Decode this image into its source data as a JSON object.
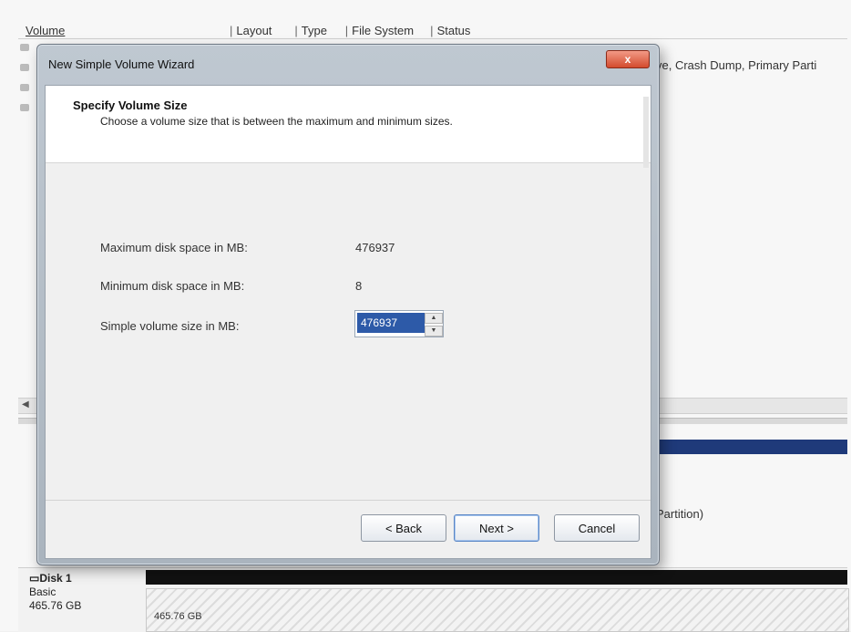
{
  "background": {
    "columns": {
      "volume": "Volume",
      "layout": "Layout",
      "type": "Type",
      "file_system": "File System",
      "status": "Status"
    },
    "status_partial": "ve, Crash Dump, Primary Parti",
    "partition_partial": "Partition)",
    "disk1": {
      "name": "Disk 1",
      "type": "Basic",
      "size": "465.76 GB",
      "unallocated_size": "465.76 GB"
    }
  },
  "wizard": {
    "title": "New Simple Volume Wizard",
    "close_label": "x",
    "page_title": "Specify Volume Size",
    "page_subtitle": "Choose a volume size that is between the maximum and minimum sizes.",
    "max_label": "Maximum disk space in MB:",
    "max_value": "476937",
    "min_label": "Minimum disk space in MB:",
    "min_value": "8",
    "size_label": "Simple volume size in MB:",
    "size_value": "476937",
    "buttons": {
      "back": "< Back",
      "next": "Next >",
      "cancel": "Cancel"
    }
  },
  "colors": {
    "disk_bar": "#1f3a7a",
    "selection": "#2d5aa8",
    "close_button": "#d34b2e"
  },
  "icons": {
    "up": "▲",
    "down": "▼",
    "scroll_left": "◀"
  }
}
